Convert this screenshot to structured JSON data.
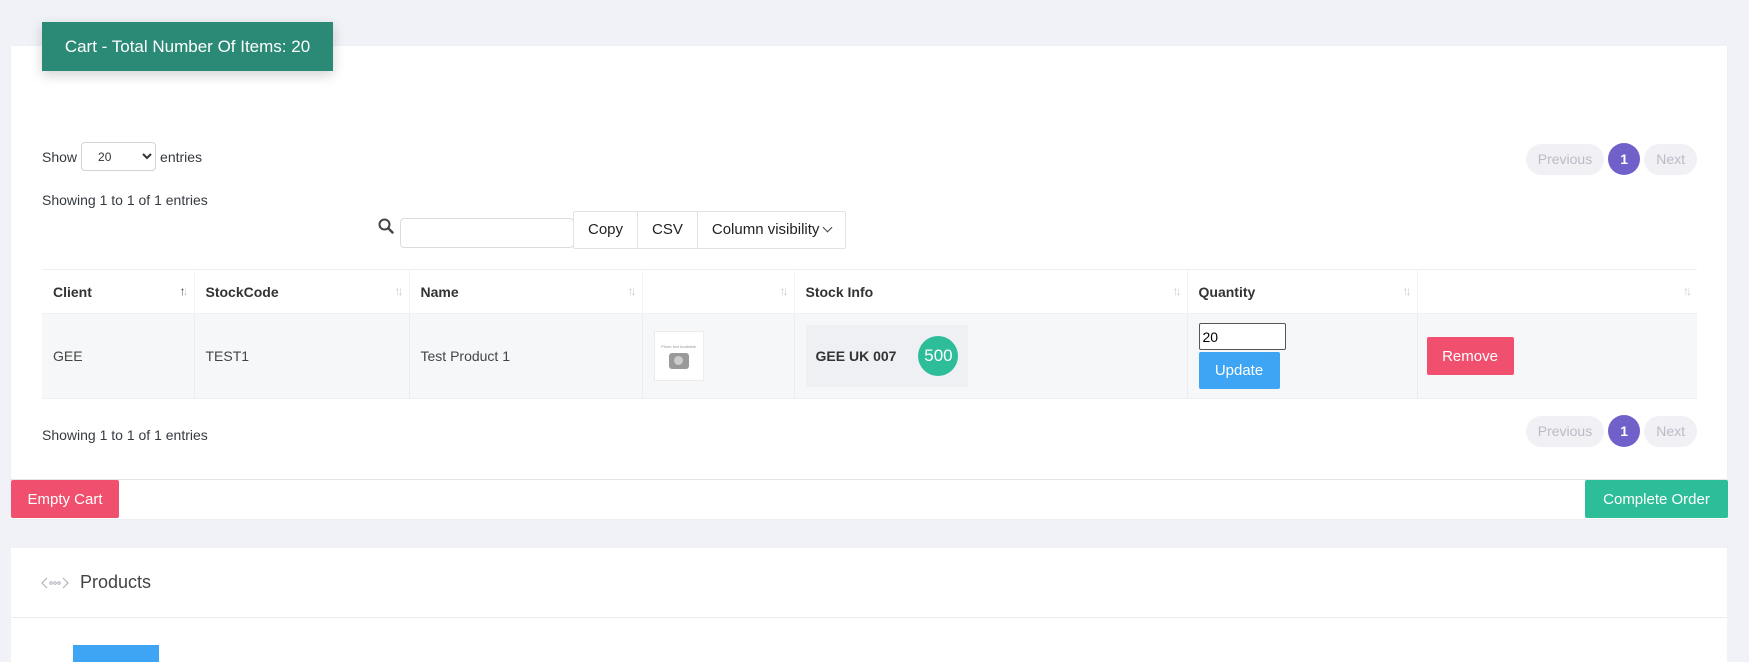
{
  "cart": {
    "title": "Cart - Total Number Of Items: 20"
  },
  "length": {
    "show_label": "Show",
    "entries_label": "entries",
    "selected": "20"
  },
  "info": {
    "top": "Showing 1 to 1 of 1 entries",
    "bottom": "Showing 1 to 1 of 1 entries"
  },
  "pagination": {
    "previous": "Previous",
    "page": "1",
    "next": "Next"
  },
  "search": {
    "value": "",
    "placeholder": ""
  },
  "buttons": {
    "copy": "Copy",
    "csv": "CSV",
    "column_visibility": "Column visibility"
  },
  "table": {
    "headers": [
      "Client",
      "StockCode",
      "Name",
      "",
      "Stock Info",
      "Quantity",
      ""
    ],
    "rows": [
      {
        "client": "GEE",
        "stockcode": "TEST1",
        "name": "Test Product 1",
        "thumb_caption": "Photo Not Available",
        "stock_label": "GEE UK 007",
        "stock_count": "500",
        "quantity": "20",
        "update_label": "Update",
        "remove_label": "Remove"
      }
    ]
  },
  "footer": {
    "empty_cart": "Empty Cart",
    "complete_order": "Complete Order"
  },
  "products": {
    "title": "Products"
  },
  "colors": {
    "cart_header": "#2b8a75",
    "pagination_active": "#6f61c9",
    "danger": "#f0506e",
    "success": "#2ebd99",
    "primary": "#3ea5f4"
  }
}
